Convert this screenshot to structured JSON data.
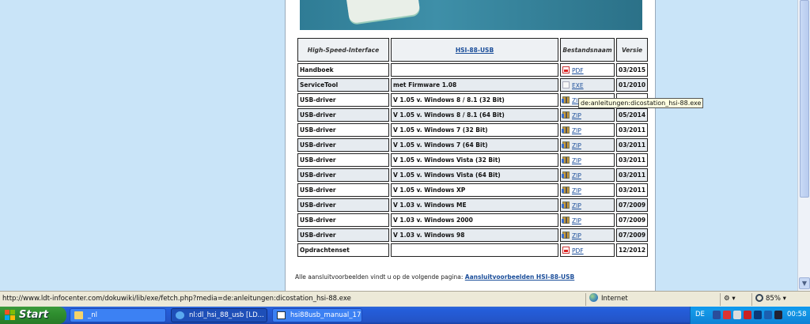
{
  "table": {
    "headers": [
      "High-Speed-Interface",
      "HSI-88-USB",
      "Bestandsnaam",
      "Versie"
    ],
    "rows": [
      {
        "name": "Handboek",
        "desc": "",
        "file": "PDF",
        "icon": "pdf-file-icon",
        "version": "03/2015"
      },
      {
        "name": "ServiceTool",
        "desc": "met Firmware 1.08",
        "file": "EXE",
        "icon": "exe-file-icon",
        "version": "01/2010"
      },
      {
        "name": "USB-driver",
        "desc": "V 1.05 v. Windows 8 / 8.1 (32 Bit)",
        "file": "ZIP",
        "icon": "zip-file-icon",
        "version": ""
      },
      {
        "name": "USB-driver",
        "desc": "V 1.05 v. Windows 8 / 8.1 (64 Bit)",
        "file": "ZIP",
        "icon": "zip-file-icon",
        "version": "05/2014"
      },
      {
        "name": "USB-driver",
        "desc": "V 1.05 v. Windows 7 (32 Bit)",
        "file": "ZIP",
        "icon": "zip-file-icon",
        "version": "03/2011"
      },
      {
        "name": "USB-driver",
        "desc": "V 1.05 v. Windows 7 (64 Bit)",
        "file": "ZIP",
        "icon": "zip-file-icon",
        "version": "03/2011"
      },
      {
        "name": "USB-driver",
        "desc": "V 1.05 v. Windows Vista (32 Bit)",
        "file": "ZIP",
        "icon": "zip-file-icon",
        "version": "03/2011"
      },
      {
        "name": "USB-driver",
        "desc": "V 1.05 v. Windows Vista (64 Bit)",
        "file": "ZIP",
        "icon": "zip-file-icon",
        "version": "03/2011"
      },
      {
        "name": "USB-driver",
        "desc": "V 1.05 v. Windows XP",
        "file": "ZIP",
        "icon": "zip-file-icon",
        "version": "03/2011"
      },
      {
        "name": "USB-driver",
        "desc": "V 1.03 v. Windows ME",
        "file": "ZIP",
        "icon": "zip-file-icon",
        "version": "07/2009"
      },
      {
        "name": "USB-driver",
        "desc": "V 1.03 v. Windows 2000",
        "file": "ZIP",
        "icon": "zip-file-icon",
        "version": "07/2009"
      },
      {
        "name": "USB-driver",
        "desc": "V 1.03 v. Windows 98",
        "file": "ZIP",
        "icon": "zip-file-icon",
        "version": "07/2009"
      },
      {
        "name": "Opdrachtenset",
        "desc": "",
        "file": "PDF",
        "icon": "pdf-file-icon",
        "version": "12/2012"
      }
    ]
  },
  "footer": {
    "text": "Alle aansluitvoorbeelden vindt u op de volgende pagina:",
    "link": "Aansluitvoorbeelden HSI-88-USB"
  },
  "tooltip": "de:anleitungen:dicostation_hsi-88.exe",
  "statusbar": {
    "url": "http://www.ldt-infocenter.com/dokuwiki/lib/exe/fetch.php?media=de:anleitungen:dicostation_hsi-88.exe",
    "zone": "Internet",
    "zoom": "85%"
  },
  "taskbar": {
    "start": "Start",
    "tasks": [
      "_nl",
      "nl:dl_hsi_88_usb [LD...",
      "hsi88usb_manual_17..."
    ],
    "language": "DE",
    "clock": "00:58"
  },
  "colors": {
    "taskbar": "#245edb",
    "start": "#2f8f2f",
    "tray": "#0e82d6",
    "link": "#1b4e9a"
  }
}
